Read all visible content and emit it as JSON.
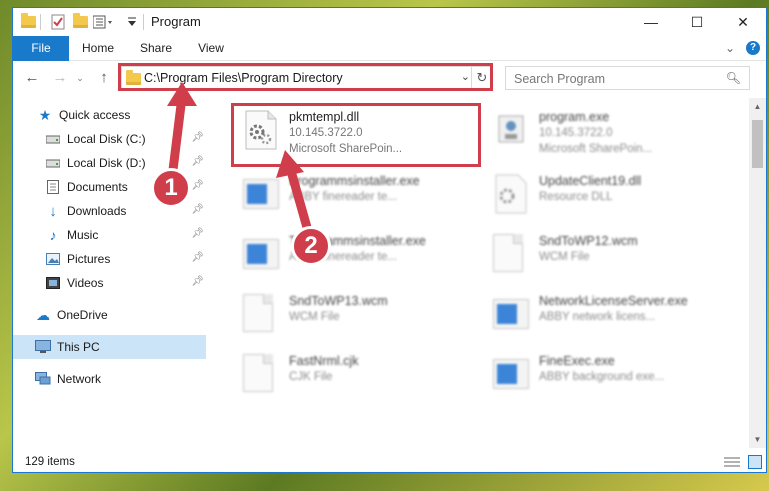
{
  "window": {
    "title": "Program",
    "minimize_glyph": "—",
    "maximize_glyph": "☐",
    "close_glyph": "✕"
  },
  "ribbon": {
    "tabs": [
      "File",
      "Home",
      "Share",
      "View"
    ],
    "help_glyph": "?",
    "expand_glyph": "⌄"
  },
  "address": {
    "path": "C:\\Program Files\\Program Directory",
    "search_placeholder": "Search Program"
  },
  "nav": {
    "items": [
      {
        "label": "Quick access",
        "icon": "star-icon"
      },
      {
        "label": "Local Disk (C:)",
        "icon": "drive-icon",
        "pinned": true
      },
      {
        "label": "Local Disk (D:)",
        "icon": "drive-icon",
        "pinned": true
      },
      {
        "label": "Documents",
        "icon": "documents-icon",
        "pinned": true
      },
      {
        "label": "Downloads",
        "icon": "downloads-icon",
        "pinned": true
      },
      {
        "label": "Music",
        "icon": "music-icon",
        "pinned": true
      },
      {
        "label": "Pictures",
        "icon": "pictures-icon",
        "pinned": true
      },
      {
        "label": "Videos",
        "icon": "videos-icon",
        "pinned": true
      },
      {
        "label": "OneDrive",
        "icon": "cloud-icon"
      },
      {
        "label": "This PC",
        "icon": "computer-icon",
        "selected": true
      },
      {
        "label": "Network",
        "icon": "network-icon"
      }
    ]
  },
  "files": [
    {
      "name": "pkmtempl.dll",
      "line1": "10.145.3722.0",
      "line2": "Microsoft SharePoin...",
      "icon": "dll-gear-icon"
    },
    {
      "name": "program.exe",
      "line1": "10.145.3722.0",
      "line2": "Microsoft SharePoin...",
      "icon": "exe-icon"
    },
    {
      "name": "Programmsinstaller.exe",
      "line1": "ABBY finereader te...",
      "line2": "",
      "icon": "exe-icon"
    },
    {
      "name": "UpdateClient19.dll",
      "line1": "Resource DLL",
      "line2": "",
      "icon": "dll-gear-icon"
    },
    {
      "name": "Tprogrammsinstaller.exe",
      "line1": "ABBY finereader te...",
      "line2": "",
      "icon": "exe-icon"
    },
    {
      "name": "SndToWP12.wcm",
      "line1": "WCM File",
      "line2": "",
      "icon": "document-icon"
    },
    {
      "name": "SndToWP13.wcm",
      "line1": "WCM File",
      "line2": "",
      "icon": "document-icon"
    },
    {
      "name": "NetworkLicenseServer.exe",
      "line1": "ABBY network licens...",
      "line2": "",
      "icon": "exe-icon"
    },
    {
      "name": "FastNrml.cjk",
      "line1": "CJK File",
      "line2": "",
      "icon": "document-icon"
    },
    {
      "name": "FineExec.exe",
      "line1": "ABBY background exe...",
      "line2": "",
      "icon": "exe-icon"
    }
  ],
  "status": {
    "count": "129 items"
  },
  "annotations": {
    "step1": "1",
    "step2": "2",
    "color": "#d03e4b"
  }
}
